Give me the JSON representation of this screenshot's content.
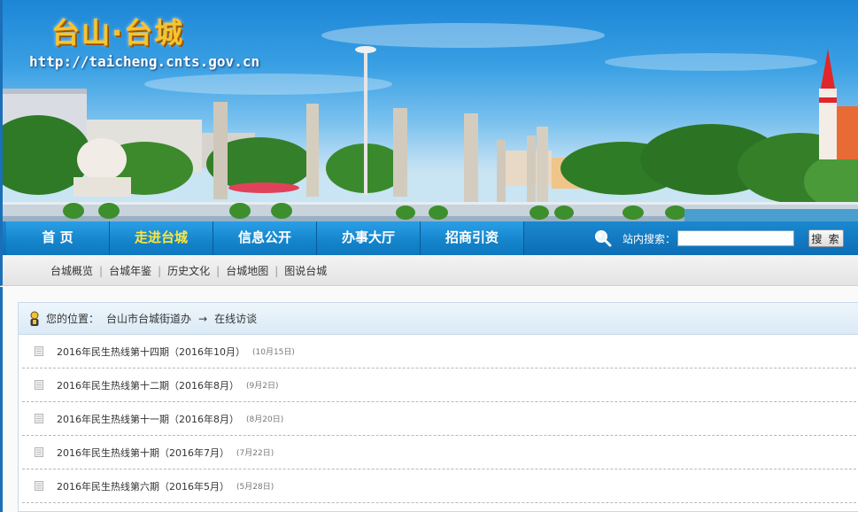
{
  "header": {
    "title": "台山·台城",
    "url": "http://taicheng.cnts.gov.cn"
  },
  "nav": {
    "items": [
      {
        "label": "首 页"
      },
      {
        "label": "走进台城"
      },
      {
        "label": "信息公开"
      },
      {
        "label": "办事大厅"
      },
      {
        "label": "招商引资"
      }
    ],
    "search_label": "站内搜索：",
    "search_value": "",
    "search_button": "搜 索"
  },
  "subnav": {
    "items": [
      "台城概览",
      "台城年鉴",
      "历史文化",
      "台城地图",
      "图说台城"
    ],
    "separator": "|"
  },
  "location": {
    "label": "您的位置：",
    "crumbs": [
      "台山市台城街道办",
      "在线访谈"
    ],
    "arrow": "→"
  },
  "articles": [
    {
      "title": "2016年民生热线第十四期（2016年10月）",
      "date": "(10月15日)"
    },
    {
      "title": "2016年民生热线第十二期（2016年8月）",
      "date": "(9月2日)"
    },
    {
      "title": "2016年民生热线第十一期（2016年8月）",
      "date": "(8月20日)"
    },
    {
      "title": "2016年民生热线第十期（2016年7月）",
      "date": "(7月22日)"
    },
    {
      "title": "2016年民生热线第六期（2016年5月）",
      "date": "(5月28日)"
    }
  ],
  "colors": {
    "nav_active": "#ffe63a",
    "nav_bg": "#1484cb",
    "title_gold": "#f6c431"
  }
}
